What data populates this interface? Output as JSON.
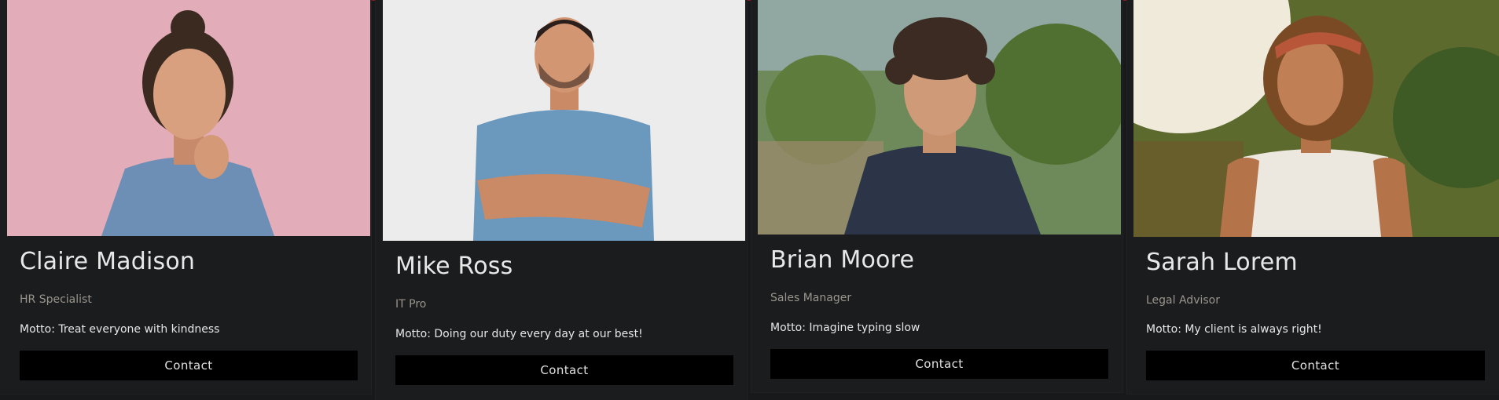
{
  "people": [
    {
      "name": "Claire Madison",
      "role": "HR Specialist",
      "motto": "Motto: Treat everyone with kindness",
      "contact_label": "Contact"
    },
    {
      "name": "Mike Ross",
      "role": "IT Pro",
      "motto": "Motto: Doing our duty every day at our best!",
      "contact_label": "Contact"
    },
    {
      "name": "Brian Moore",
      "role": "Sales Manager",
      "motto": "Motto: Imagine typing slow",
      "contact_label": "Contact"
    },
    {
      "name": "Sarah Lorem",
      "role": "Legal Advisor",
      "motto": "Motto: My client is always right!",
      "contact_label": "Contact"
    }
  ],
  "colors": {
    "page_background": "#18191b",
    "card_background": "#1b1c1e",
    "name_text": "#e8e8e8",
    "role_text": "#9a958c",
    "button_background": "#000000"
  }
}
